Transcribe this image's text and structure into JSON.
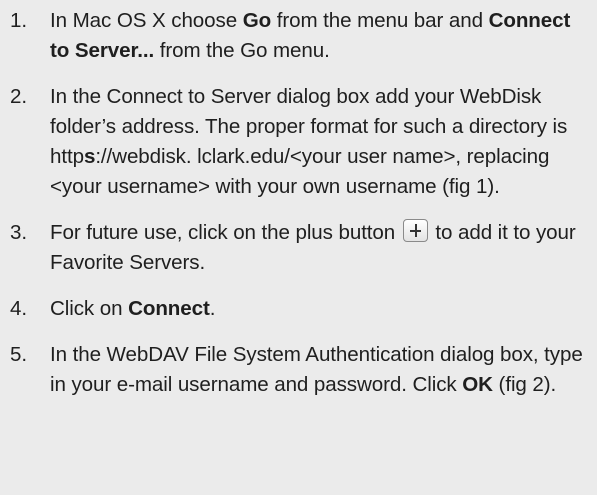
{
  "steps": [
    {
      "number": "1.",
      "t1": "In Mac OS X choose ",
      "b1": "Go",
      "t2": " from the menu bar and ",
      "b2": "Connect to Server...",
      "t3": " from the Go menu."
    },
    {
      "number": "2.",
      "t1": "In the Connect to Server dialog box add your WebDisk folder’s address.  The proper format for such a directory is http",
      "b1": "s",
      "t2": "://webdisk. lclark.edu/<your user name>, replacing <your username> with your own username (fig 1)."
    },
    {
      "number": "3.",
      "t1": "For future use, click on the plus button ",
      "icon": "plus-icon",
      "t2": " to add it to your Favorite Servers."
    },
    {
      "number": "4.",
      "t1": "Click on ",
      "b1": "Connect",
      "t2": "."
    },
    {
      "number": "5.",
      "t1": "In the WebDAV File System Authentication dialog box, type in your e-mail username and password. Click ",
      "b1": "OK",
      "t2": " (fig 2)."
    }
  ]
}
